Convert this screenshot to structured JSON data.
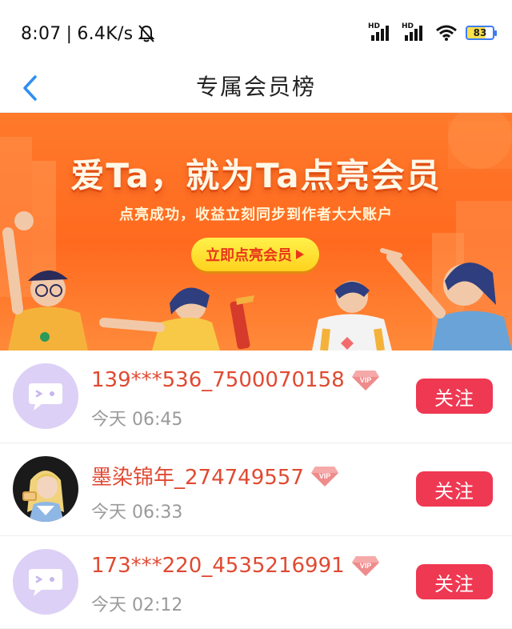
{
  "status_bar": {
    "time": "8:07",
    "speed": "6.4K/s",
    "battery": "83",
    "hd_label": "HD",
    "icons": [
      "bell-off-icon",
      "signal-icon",
      "signal-icon",
      "wifi-icon",
      "battery-icon"
    ]
  },
  "header": {
    "title": "专属会员榜",
    "back_icon": "chevron-left-icon"
  },
  "banner": {
    "headline": "爱Ta，就为Ta点亮会员",
    "subtitle": "点亮成功，收益立刻同步到作者大大账户",
    "cta": "立即点亮会员",
    "colors": {
      "bg": "#ff6a1f",
      "cta_bg": "#ffe02e",
      "cta_text": "#e8361a"
    }
  },
  "members": [
    {
      "name": "139***536_7500070158",
      "time": "今天 06:45",
      "follow_label": "关注",
      "badge": "VIP",
      "avatar": "default"
    },
    {
      "name": "墨染锦年_274749557",
      "time": "今天 06:33",
      "follow_label": "关注",
      "badge": "VIP",
      "avatar": "photo"
    },
    {
      "name": "173***220_4535216991",
      "time": "今天 02:12",
      "follow_label": "关注",
      "badge": "VIP",
      "avatar": "default"
    }
  ],
  "colors": {
    "name_text": "#e04a32",
    "follow_button": "#ef3852",
    "avatar_default_bg": "#ddd0f6"
  }
}
